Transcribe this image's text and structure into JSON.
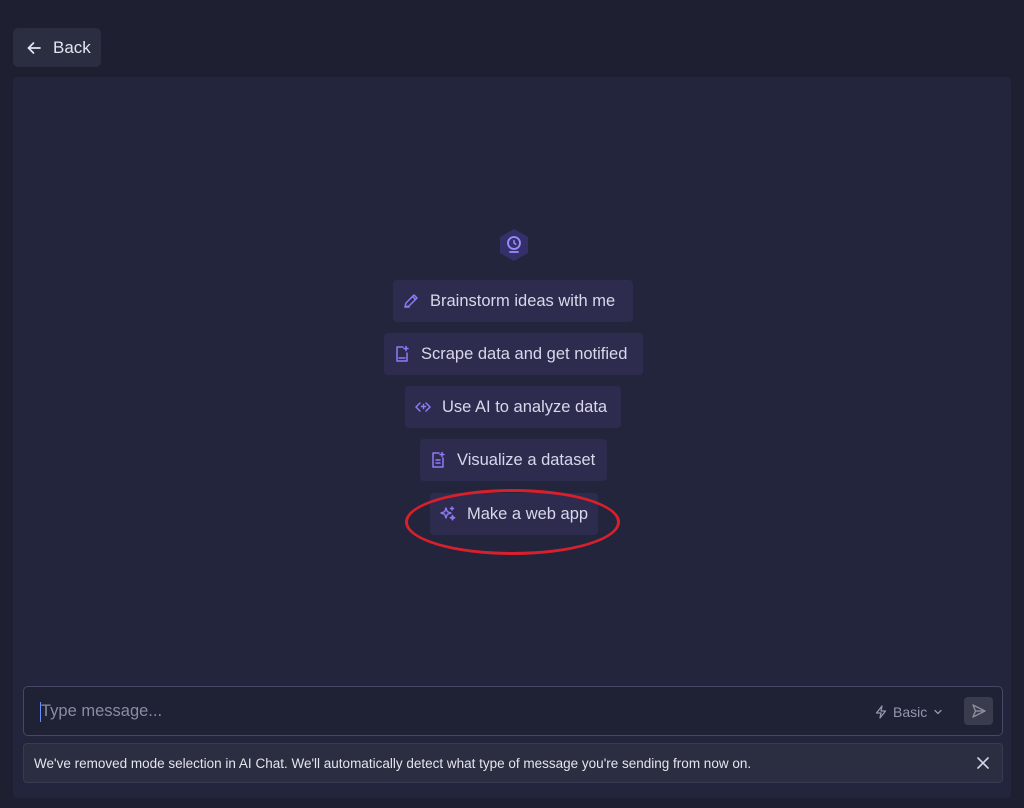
{
  "back": {
    "label": "Back",
    "icon": "arrow-left-icon"
  },
  "suggestions": [
    {
      "label": "Brainstorm ideas with me",
      "icon": "pencil-icon"
    },
    {
      "label": "Scrape data and get notified",
      "icon": "document-sparkle-icon"
    },
    {
      "label": "Use AI to analyze data",
      "icon": "code-sparkle-icon"
    },
    {
      "label": "Visualize a dataset",
      "icon": "chart-document-icon"
    },
    {
      "label": "Make a web app",
      "icon": "sparkles-icon"
    }
  ],
  "composer": {
    "placeholder": "Type message...",
    "value": "",
    "mode": "Basic",
    "mode_icon": "lightning-icon",
    "send_icon": "send-icon"
  },
  "notice": {
    "text": "We've removed mode selection in AI Chat. We'll automatically detect what type of message you're sending from now on.",
    "close_icon": "close-icon"
  },
  "colors": {
    "background": "#1e2031",
    "panel": "#23253c",
    "suggestion_bg": "#2d2c4e",
    "accent": "#7b6cf0",
    "highlight_ring": "#d8202d"
  }
}
